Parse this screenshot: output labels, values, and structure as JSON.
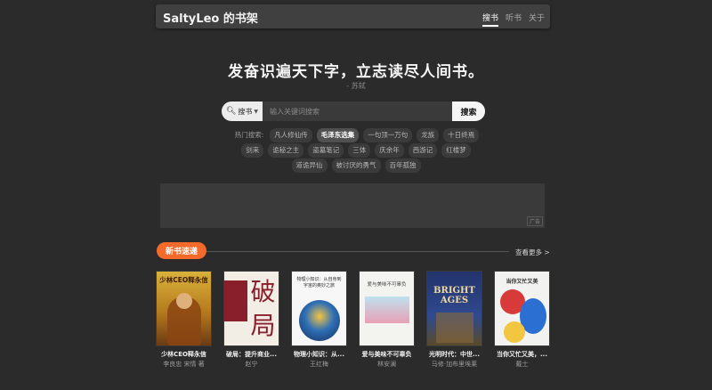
{
  "header": {
    "brand": "SaltyLeo 的书架",
    "nav": [
      {
        "label": "搜书",
        "active": true
      },
      {
        "label": "听书",
        "active": false
      },
      {
        "label": "关于",
        "active": false
      }
    ]
  },
  "hero": {
    "quote": "发奋识遍天下字，立志读尽人间书。",
    "author": "- 苏轼"
  },
  "search": {
    "type_label": "搜书",
    "placeholder": "输入关键词搜索",
    "value": "",
    "button_label": "搜索"
  },
  "hot": {
    "label": "热门搜索:",
    "tags": [
      "凡人修仙传",
      "毛泽东选集",
      "一句顶一万句",
      "龙族",
      "十日终焉",
      "剑来",
      "诡秘之主",
      "盗墓笔记",
      "三体",
      "庆余年",
      "西游记",
      "红楼梦",
      "道诡异仙",
      "被讨厌的勇气",
      "百年孤独"
    ],
    "highlighted": "毛泽东选集"
  },
  "ad": {
    "badge": "广告"
  },
  "section": {
    "title": "新书速递",
    "more": "查看更多 >",
    "accent": "#f36a2a"
  },
  "books": [
    {
      "title": "少林CEO释永信",
      "author": "李良忠 宋情 著",
      "cover": {
        "bg": "#c79a2a",
        "text": "少林CEO释永信"
      }
    },
    {
      "title": "破局：提升商业...",
      "author": "赵宁",
      "cover": {
        "bg": "#f2eee6",
        "text": "破局"
      }
    },
    {
      "title": "物理小知识：从...",
      "author": "王红梅",
      "cover": {
        "bg": "#f7f7f7",
        "text": "物理小知识：从自身到宇宙的奥妙之旅"
      }
    },
    {
      "title": "爱与美味不可辜负",
      "author": "林安澜",
      "cover": {
        "bg": "#f3f3ef",
        "text": "爱与美味不可辜负"
      }
    },
    {
      "title": "光明时代：中世...",
      "author": "马修·加布里埃莱",
      "cover": {
        "bg": "#2a3c7a",
        "text": "BRIGHT AGES"
      }
    },
    {
      "title": "当你又忙又美，...",
      "author": "戴士",
      "cover": {
        "bg": "#f2f2f0",
        "text": "当你又忙又美"
      }
    }
  ]
}
